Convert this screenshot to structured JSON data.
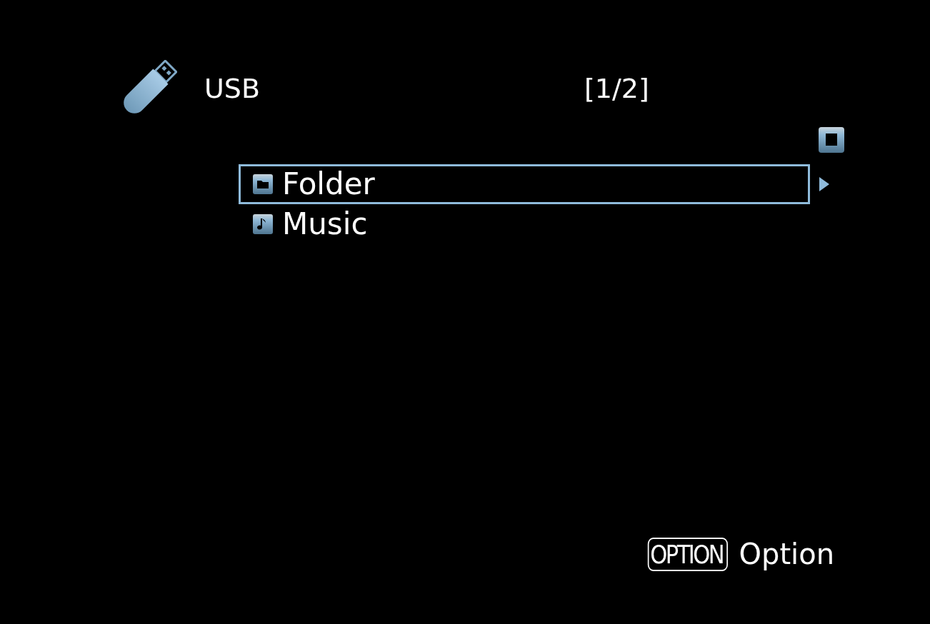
{
  "header": {
    "source": "USB",
    "page": "[1/2]"
  },
  "items": [
    {
      "kind": "folder",
      "label": "Folder",
      "selected": true
    },
    {
      "kind": "music",
      "label": "Music",
      "selected": false
    }
  ],
  "footer": {
    "key": "OPTION",
    "label": "Option"
  }
}
